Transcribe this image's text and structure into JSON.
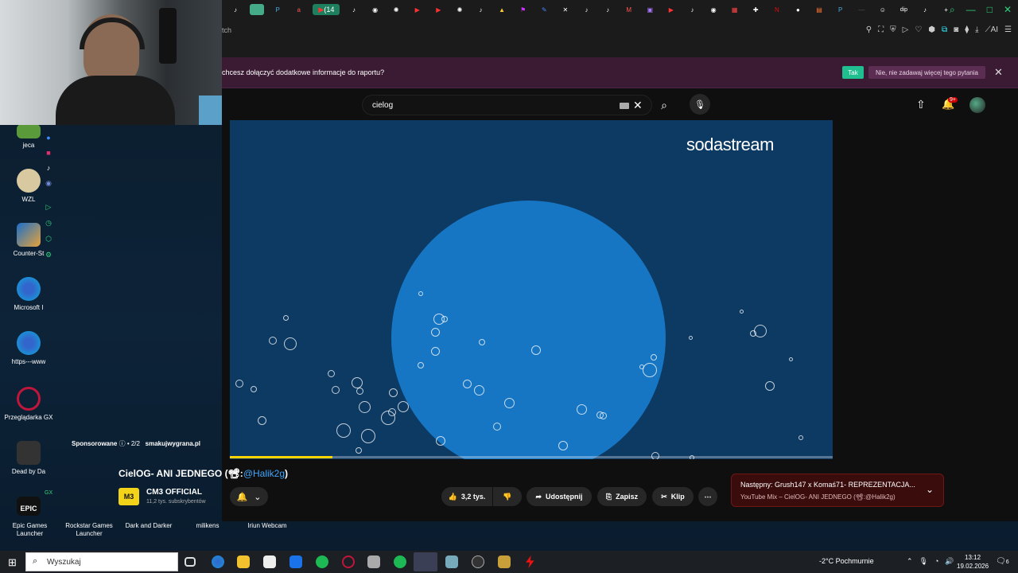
{
  "desktop": {
    "icons": [
      {
        "label": "jeca",
        "color": "#5a9a3a"
      },
      {
        "label": "WZL",
        "color": "#d9c9a0"
      },
      {
        "label": "Counter-St",
        "color": "#e8a23a"
      },
      {
        "label": "Microsoft I",
        "color": "#1b8fd6"
      },
      {
        "label": "https---www",
        "color": "#1b8fd6"
      },
      {
        "label": "Przeglądarka GX",
        "color": "#c0163b"
      },
      {
        "label": "Dead by Da",
        "color": "#444"
      },
      {
        "label": "Epic Games Launcher",
        "color": "#111"
      }
    ],
    "bottom_labels": [
      "Epic Games Launcher",
      "Rockstar Games Launcher",
      "Dark and Darker",
      "milikens",
      "Iriun Webcam"
    ],
    "epic_icon_text": "EPIC",
    "gx_label": "GX"
  },
  "browser": {
    "active_tab_label": "(14",
    "url_fragment": "tch",
    "ai_label": "AI",
    "infobar": {
      "message": "chcesz dołączyć dodatkowe informacje do raportu?",
      "yes_label": "Tak",
      "no_label": "Nie, nie zadawaj więcej tego pytania"
    }
  },
  "youtube": {
    "search_query": "cielog",
    "notification_badge": "9+",
    "video": {
      "brand": "sodastream",
      "progress_fraction": 0.17,
      "sponsor_label": "Sponsorowane",
      "sponsor_count": "• 2/2",
      "sponsor_site": "smakujwygrana.pl"
    },
    "title_text": "CielOG- ANI JEDNEGO (📽:",
    "title_link": "@Halik2g",
    "title_end": ")",
    "channel": {
      "logo_text": "M3",
      "name": "CM3 OFFICIAL",
      "subs": "11,2 tys. subskrybentów"
    },
    "actions": {
      "likes": "3,2 tys.",
      "share": "Udostępnij",
      "save": "Zapisz",
      "clip": "Klip"
    },
    "next_up": {
      "title": "Następny: Grush147 x Komaś71- REPREZENTACJA...",
      "subtitle": "YouTube Mix – CielOG- ANI JEDNEGO (📽:@Halik2g)"
    }
  },
  "taskbar": {
    "search_placeholder": "Wyszukaj",
    "weather": "-2°C  Pochmurnie",
    "time": "13:12",
    "date": "19.02.2026",
    "notif_count": "6"
  }
}
